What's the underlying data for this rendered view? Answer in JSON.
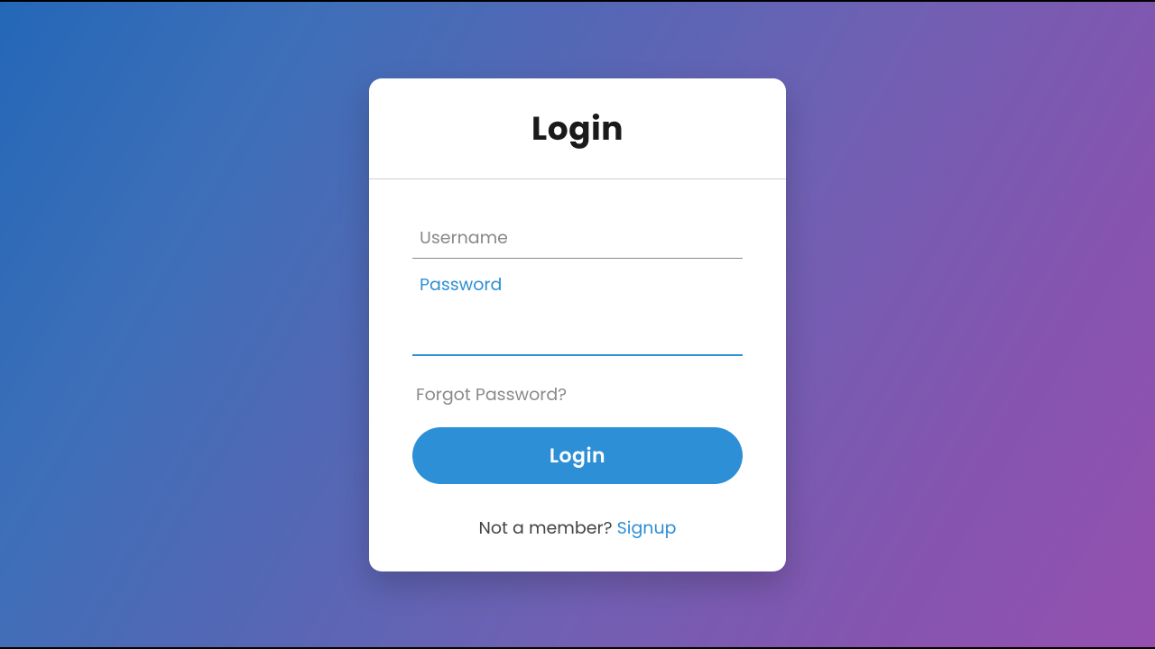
{
  "card": {
    "title": "Login",
    "username": {
      "placeholder": "Username",
      "value": ""
    },
    "password": {
      "label": "Password",
      "value": ""
    },
    "forgot_label": "Forgot Password?",
    "login_button_label": "Login",
    "signup_prompt": "Not a member? ",
    "signup_link": "Signup"
  },
  "colors": {
    "accent": "#2d8fd5",
    "gradient_start": "#2467b8",
    "gradient_end": "#9450af"
  }
}
